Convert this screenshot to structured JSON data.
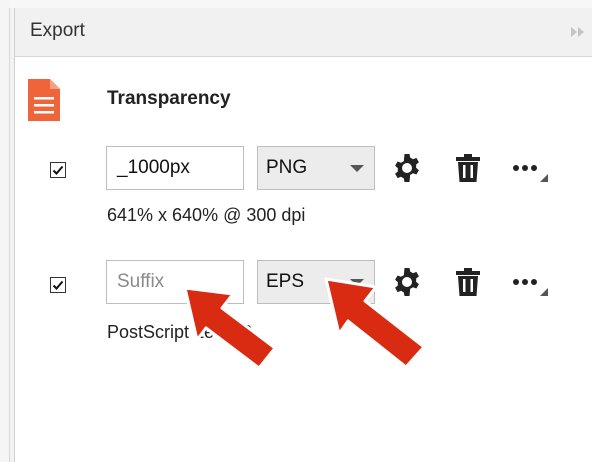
{
  "panel": {
    "title": "Export",
    "collapse_icon": "double-chevron-right-icon"
  },
  "section": {
    "title": "Transparency",
    "icon": "document-icon",
    "icon_color": "#f0643c"
  },
  "rows": [
    {
      "checked": true,
      "suffix_value": "_1000px",
      "format": "PNG",
      "info": "641% x 640% @ 300 dpi"
    },
    {
      "checked": true,
      "suffix_placeholder": "Suffix",
      "format": "EPS",
      "info": "PostScript Level 2"
    }
  ],
  "annotations": {
    "arrow_color": "#d92a12",
    "arrow_outline": "#ffffff"
  }
}
